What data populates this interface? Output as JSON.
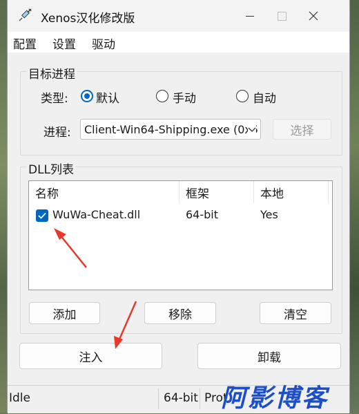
{
  "window": {
    "title": "Xenos汉化修改版"
  },
  "menu": {
    "items": [
      "配置",
      "设置",
      "驱动"
    ]
  },
  "target": {
    "group_label": "目标进程",
    "type_label": "类型:",
    "radios": [
      {
        "label": "默认",
        "checked": true
      },
      {
        "label": "手动",
        "checked": false
      },
      {
        "label": "自动",
        "checked": false
      }
    ],
    "process_label": "进程:",
    "process_value": "Client-Win64-Shipping.exe (0x5",
    "select_button": "选择"
  },
  "dll": {
    "group_label": "DLL列表",
    "columns": [
      "名称",
      "框架",
      "本地"
    ],
    "rows": [
      {
        "checked": true,
        "name": "WuWa-Cheat.dll",
        "arch": "64-bit",
        "local": "Yes"
      }
    ],
    "add_button": "添加",
    "remove_button": "移除",
    "clear_button": "清空"
  },
  "actions": {
    "inject_button": "注入",
    "unload_button": "卸载"
  },
  "status": {
    "state": "Idle",
    "arch": "64-bit",
    "mode": "Prot",
    "watermark": "阿影博客"
  },
  "colors": {
    "accent": "#0067c0",
    "arrow": "#e8382a",
    "watermark": "#1a4fc8"
  },
  "icons": {
    "app": "syringe-icon",
    "minimize": "minimize-icon",
    "maximize": "maximize-icon",
    "close": "close-icon"
  }
}
